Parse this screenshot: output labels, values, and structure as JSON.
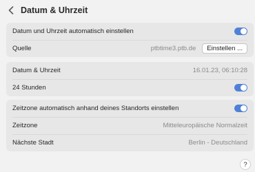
{
  "header": {
    "title": "Datum & Uhrzeit",
    "back_icon": "chevron-left-icon"
  },
  "group1": {
    "auto_label": "Datum und Uhrzeit automatisch einstellen",
    "auto_on": true,
    "source_label": "Quelle",
    "source_value": "ptbtime3.ptb.de",
    "set_button": "Einstellen ..."
  },
  "group2": {
    "datetime_label": "Datum & Uhrzeit",
    "datetime_value": "16.01.23, 06:10:28",
    "h24_label": "24 Stunden",
    "h24_on": true
  },
  "group3": {
    "tz_auto_label": "Zeitzone automatisch anhand deines Standorts einstellen",
    "tz_auto_on": true,
    "tz_label": "Zeitzone",
    "tz_value": "Mitteleuropäische Normalzeit",
    "city_label": "Nächste Stadt",
    "city_value": "Berlin - Deutschland"
  },
  "help": {
    "label": "?"
  },
  "colors": {
    "accent": "#4f82d6",
    "panel": "#e7e7e7",
    "background": "#f2f2f2"
  }
}
